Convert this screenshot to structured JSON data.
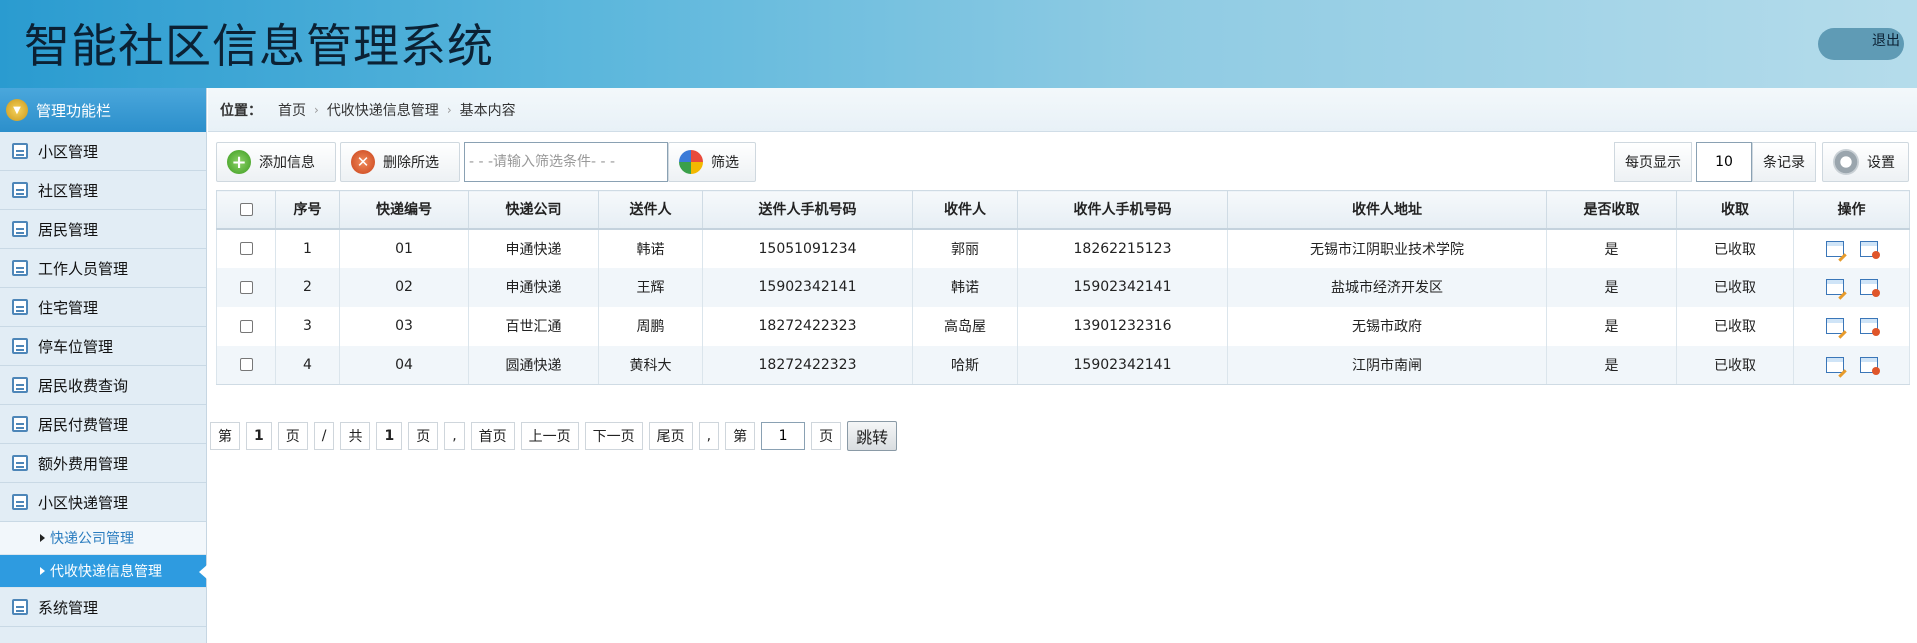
{
  "app": {
    "title": "智能社区信息管理系统",
    "logout_label": "退出"
  },
  "sidebar": {
    "header": "管理功能栏",
    "items": [
      {
        "label": "小区管理"
      },
      {
        "label": "社区管理"
      },
      {
        "label": "居民管理"
      },
      {
        "label": "工作人员管理"
      },
      {
        "label": "住宅管理"
      },
      {
        "label": "停车位管理"
      },
      {
        "label": "居民收费查询"
      },
      {
        "label": "居民付费管理"
      },
      {
        "label": "额外费用管理"
      },
      {
        "label": "小区快递管理"
      }
    ],
    "sub_items": [
      {
        "label": "快递公司管理"
      },
      {
        "label": "代收快递信息管理"
      }
    ],
    "last_item": {
      "label": "系统管理"
    }
  },
  "breadcrumb": {
    "prefix": "位置：",
    "items": [
      "首页",
      "代收快递信息管理",
      "基本内容"
    ]
  },
  "toolbar": {
    "add_label": "添加信息",
    "delete_label": "删除所选",
    "filter_placeholder": "- - -请输入筛选条件- - -",
    "filter_label": "筛选",
    "per_page_label": "每页显示",
    "per_page_value": "10",
    "records_label": "条记录",
    "settings_label": "设置"
  },
  "table": {
    "columns": [
      "序号",
      "快递编号",
      "快递公司",
      "送件人",
      "送件人手机号码",
      "收件人",
      "收件人手机号码",
      "收件人地址",
      "是否收取",
      "收取",
      "操作"
    ],
    "rows": [
      [
        "1",
        "01",
        "申通快递",
        "韩诺",
        "15051091234",
        "郭丽",
        "18262215123",
        "无锡市江阴职业技术学院",
        "是",
        "已收取"
      ],
      [
        "2",
        "02",
        "申通快递",
        "王辉",
        "15902342141",
        "韩诺",
        "15902342141",
        "盐城市经济开发区",
        "是",
        "已收取"
      ],
      [
        "3",
        "03",
        "百世汇通",
        "周鹏",
        "18272422323",
        "高岛屋",
        "13901232316",
        "无锡市政府",
        "是",
        "已收取"
      ],
      [
        "4",
        "04",
        "圆通快递",
        "黄科大",
        "18272422323",
        "哈斯",
        "15902342141",
        "江阴市南闸",
        "是",
        "已收取"
      ]
    ]
  },
  "pager": {
    "di": "第",
    "current": "1",
    "ye": "页",
    "slash": "/",
    "gong": "共",
    "total": "1",
    "ye2": "页",
    "comma": ",",
    "first": "首页",
    "prev": "上一页",
    "next": "下一页",
    "last": "尾页",
    "comma2": ",",
    "di2": "第",
    "jump_value": "1",
    "ye3": "页",
    "jump_label": "跳转"
  }
}
